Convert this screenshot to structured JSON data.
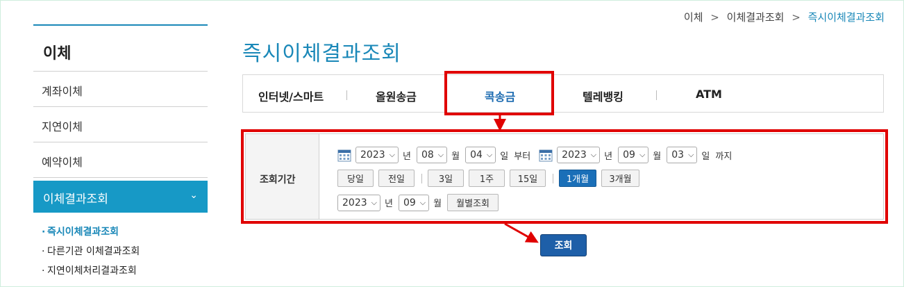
{
  "breadcrumb": {
    "items": [
      "이체",
      "이체결과조회",
      "즉시이체결과조회"
    ],
    "separator": ">"
  },
  "sidebar": {
    "title": "이체",
    "items": [
      {
        "label": "계좌이체"
      },
      {
        "label": "지연이체"
      },
      {
        "label": "예약이체"
      }
    ],
    "active": {
      "label": "이체결과조회",
      "chevron": "⌄"
    },
    "subitems": [
      {
        "label": "즉시이체결과조회"
      },
      {
        "label": "다른기관 이체결과조회"
      },
      {
        "label": "지연이체처리결과조회"
      }
    ]
  },
  "page": {
    "title": "즉시이체결과조회"
  },
  "tabs": [
    {
      "label": "인터넷/스마트"
    },
    {
      "label": "올원송금"
    },
    {
      "label": "콕송금"
    },
    {
      "label": "텔레뱅킹"
    },
    {
      "label": "ATM"
    }
  ],
  "search": {
    "period_label": "조회기간",
    "from": {
      "year": "2023",
      "month": "08",
      "day": "04",
      "suffix": "부터"
    },
    "to": {
      "year": "2023",
      "month": "09",
      "day": "03",
      "suffix": "까지"
    },
    "units": {
      "year": "년",
      "month": "월",
      "day": "일"
    },
    "quick_buttons": [
      {
        "label": "당일"
      },
      {
        "label": "전일"
      },
      {
        "label": "3일"
      },
      {
        "label": "1주"
      },
      {
        "label": "15일"
      },
      {
        "label": "1개월"
      },
      {
        "label": "3개월"
      }
    ],
    "monthly": {
      "year": "2023",
      "month": "09",
      "button": "월별조회"
    },
    "submit_label": "조회"
  },
  "colors": {
    "accent": "#1a88b8",
    "highlight": "#e00000",
    "submit": "#1e5fa8",
    "active_quick": "#1a6fb8"
  },
  "icons": {
    "calendar": "calendar-icon",
    "dropdown": "chevron-down-icon"
  }
}
